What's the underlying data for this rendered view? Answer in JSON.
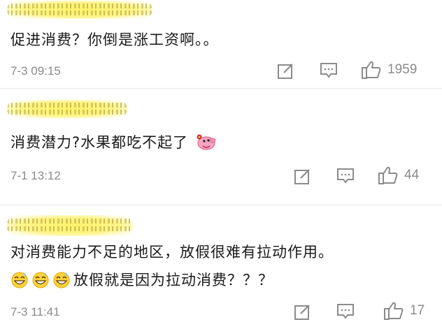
{
  "comments": [
    {
      "text": "促进消费？你倒是涨工资啊。。",
      "timestamp": "7-3 09:15",
      "likes": "1959"
    },
    {
      "text": "消费潜力?水果都吃不起了",
      "timestamp": "7-1 13:12",
      "likes": "44"
    },
    {
      "text_line1": "对消费能力不足的地区，放假很难有拉动作用。",
      "text_line2": "放假就是因为拉动消费？？？",
      "timestamp": "7-3 11:41",
      "likes": "17"
    }
  ],
  "icons": {
    "edit": "edit-icon",
    "comment": "comment-icon",
    "like": "thumbs-up-icon",
    "emoji_pig": "peppa-pig-emoji",
    "emoji_grin": "grin-sweat-emoji"
  },
  "colors": {
    "icon": "#8b8b8b",
    "username_highlight": "#fff36a",
    "divider": "#e6e6e6"
  }
}
